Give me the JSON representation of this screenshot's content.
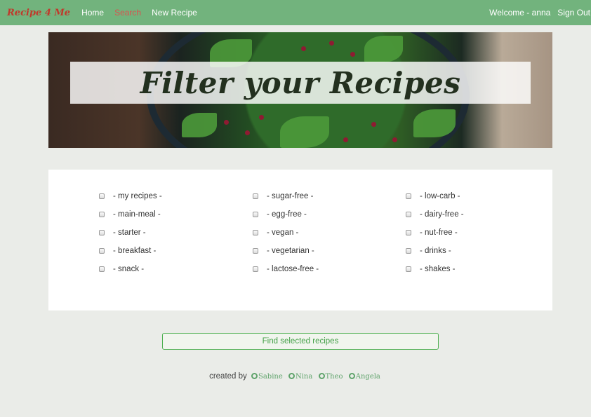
{
  "navbar": {
    "brand": "Recipe 4 Me",
    "links": [
      {
        "label": "Home"
      },
      {
        "label": "Search"
      },
      {
        "label": "New Recipe"
      }
    ],
    "welcome": "Welcome - anna",
    "sign_out": "Sign Out"
  },
  "hero": {
    "title": "Filter your Recipes"
  },
  "filters": {
    "options": [
      {
        "label": "- my recipes -",
        "checked": false
      },
      {
        "label": "- main-meal -",
        "checked": false
      },
      {
        "label": "- starter -",
        "checked": false
      },
      {
        "label": "- breakfast -",
        "checked": false
      },
      {
        "label": "- snack -",
        "checked": false
      },
      {
        "label": "- sugar-free -",
        "checked": false
      },
      {
        "label": "- egg-free -",
        "checked": false
      },
      {
        "label": "- vegan -",
        "checked": false
      },
      {
        "label": "- vegetarian -",
        "checked": false
      },
      {
        "label": "- lactose-free -",
        "checked": false
      },
      {
        "label": "- low-carb -",
        "checked": false
      },
      {
        "label": "- dairy-free -",
        "checked": false
      },
      {
        "label": "- nut-free -",
        "checked": false
      },
      {
        "label": "- drinks -",
        "checked": false
      },
      {
        "label": "- shakes -",
        "checked": false
      }
    ],
    "submit_label": "Find selected recipes"
  },
  "footer": {
    "created_by": "created by",
    "authors": [
      "Sabine",
      "Nina",
      "Theo",
      "Angela"
    ],
    "author_icon": "github-icon"
  },
  "colors": {
    "navbar": "#72b37d",
    "brand": "#c0392b",
    "active_link": "#d9534f",
    "accent_green": "#4caf50",
    "background": "#eaece8"
  }
}
